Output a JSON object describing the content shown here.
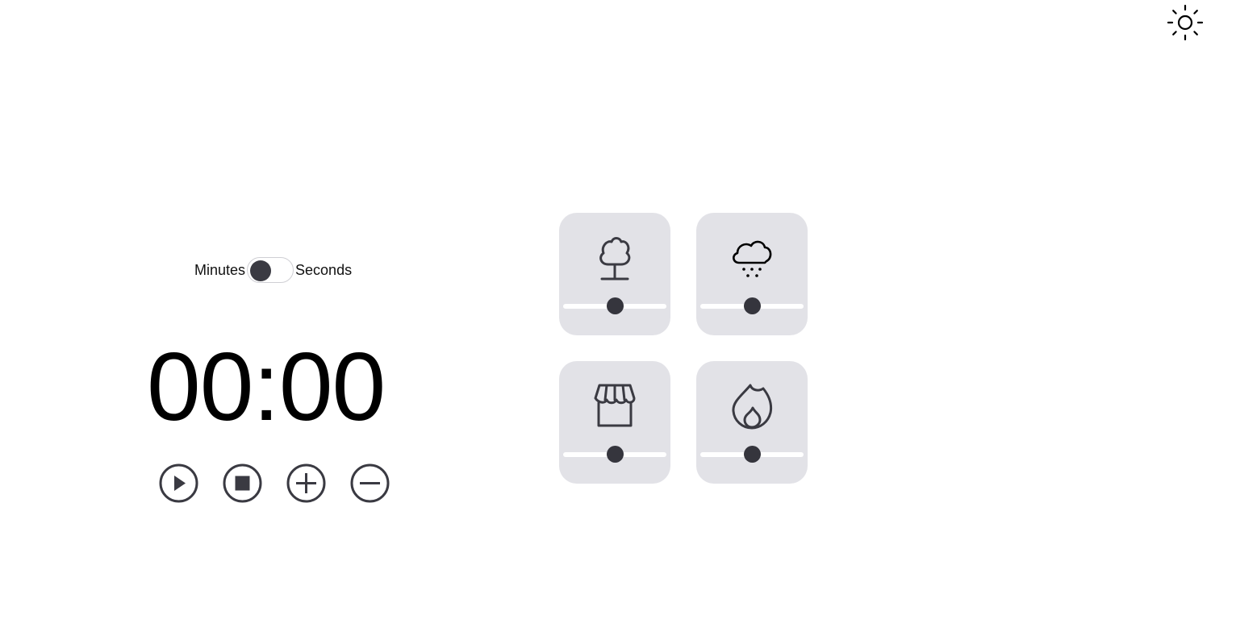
{
  "theme_toggle": {
    "icon": "sun-icon"
  },
  "unit_toggle": {
    "left_label": "Minutes",
    "right_label": "Seconds",
    "selected": "Minutes"
  },
  "timer": {
    "display": "00:00"
  },
  "controls": [
    {
      "icon": "play-icon"
    },
    {
      "icon": "stop-icon"
    },
    {
      "icon": "plus-icon"
    },
    {
      "icon": "minus-icon"
    }
  ],
  "sounds": [
    {
      "icon": "tree-icon",
      "volume": 0.5
    },
    {
      "icon": "snow-cloud-icon",
      "volume": 0.5
    },
    {
      "icon": "storefront-icon",
      "volume": 0.5
    },
    {
      "icon": "flame-icon",
      "volume": 0.5
    }
  ],
  "colors": {
    "card_bg": "#e2e2e7",
    "icon": "#3a3a42",
    "slider_track": "#ffffff",
    "slider_thumb": "#35353d"
  }
}
